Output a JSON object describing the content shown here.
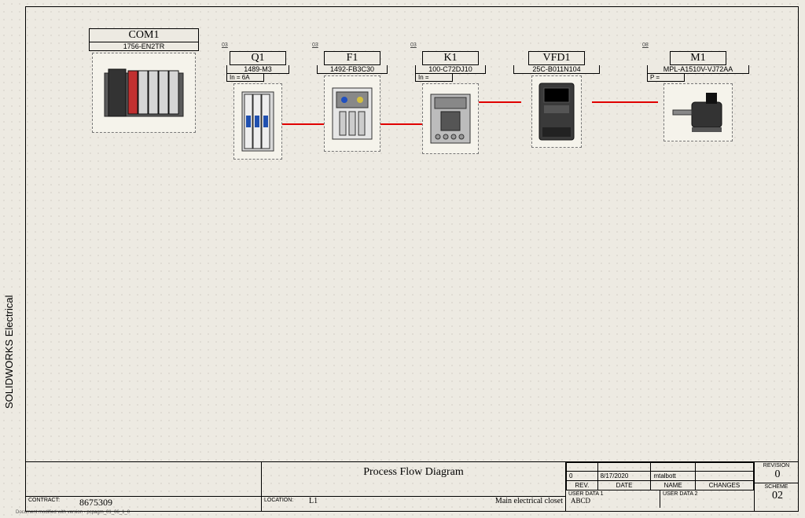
{
  "sidebar_label": "SOLIDWORKS Electrical",
  "fineprint": "Document modified with version - pcpagm_01_06_1_0",
  "components": {
    "com1": {
      "ref": "",
      "name": "COM1",
      "part": "1756-EN2TR"
    },
    "q1": {
      "ref": "03",
      "name": "Q1",
      "part": "1489-M3",
      "param": "In = 6A"
    },
    "f1": {
      "ref": "03",
      "name": "F1",
      "part": "1492-FB3C30"
    },
    "k1": {
      "ref": "03",
      "name": "K1",
      "part": "100-C72DJ10",
      "param": "In ="
    },
    "vfd1": {
      "ref": "",
      "name": "VFD1",
      "part": "25C-B011N104"
    },
    "m1": {
      "ref": "08",
      "name": "M1",
      "part": "MPL-A1510V-VJ72AA",
      "param": "P ="
    }
  },
  "title_block": {
    "title": "Process Flow Diagram",
    "contract_label": "CONTRACT:",
    "contract": "8675309",
    "location_label": "LOCATION:",
    "location": "L1",
    "sub_location": "Main electrical closet",
    "rev_headers": {
      "rev": "REV.",
      "date": "DATE",
      "name": "NAME",
      "changes": "CHANGES"
    },
    "rev_row": {
      "rev": "0",
      "date": "8/17/2020",
      "name": "mtalbott",
      "changes": ""
    },
    "userdata1_label": "User data 1",
    "userdata1": "ABCD",
    "userdata2_label": "User data 2",
    "userdata2": "",
    "revision_label": "REVISION",
    "revision": "0",
    "scheme_label": "SCHEME",
    "scheme": "02"
  }
}
